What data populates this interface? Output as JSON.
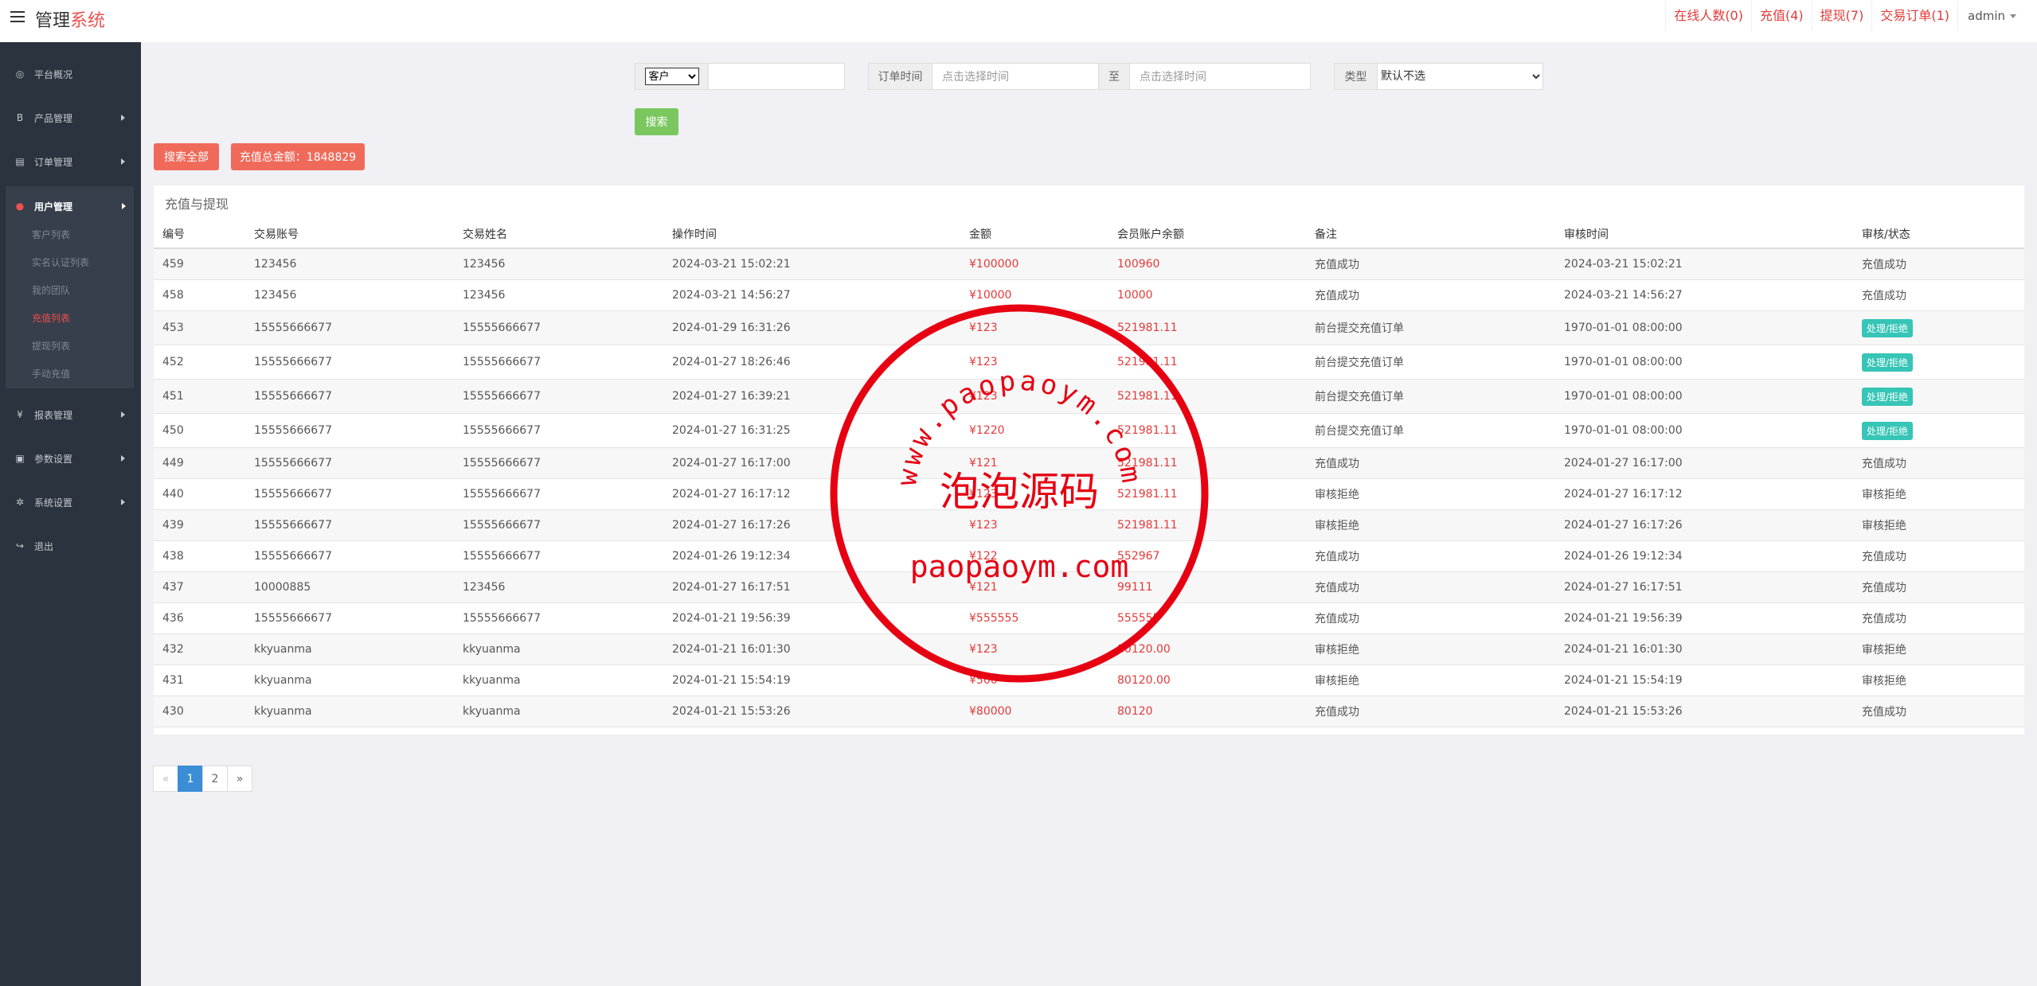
{
  "header": {
    "brand_main": "管理",
    "brand_accent": "系统",
    "links": [
      "在线人数(0)",
      "充值(4)",
      "提现(7)",
      "交易订单(1)"
    ],
    "user": "admin"
  },
  "sidebar": {
    "items": [
      {
        "label": "平台概况",
        "icon": "dashboard-icon",
        "glyph": "◎"
      },
      {
        "label": "产品管理",
        "icon": "bitcoin-icon",
        "glyph": "B"
      },
      {
        "label": "订单管理",
        "icon": "clipboard-icon",
        "glyph": "▤"
      },
      {
        "label": "用户管理",
        "icon": "user-icon",
        "glyph": "●"
      },
      {
        "label": "报表管理",
        "icon": "yen-icon",
        "glyph": "¥"
      },
      {
        "label": "参数设置",
        "icon": "briefcase-icon",
        "glyph": "▣"
      },
      {
        "label": "系统设置",
        "icon": "gears-icon",
        "glyph": "✲"
      },
      {
        "label": "退出",
        "icon": "sign-out-icon",
        "glyph": "↪"
      }
    ],
    "sub_items": [
      "客户列表",
      "实名认证列表",
      "我的团队",
      "充值列表",
      "提现列表",
      "手动充值"
    ]
  },
  "filters": {
    "customer_select": "客户",
    "time_label": "订单时间",
    "start_placeholder": "点击选择时间",
    "to_label": "至",
    "end_placeholder": "点击选择时间",
    "type_label": "类型",
    "type_select": "默认不选",
    "search_label": "搜索",
    "search_all_label": "搜索全部",
    "total_label": "充值总金额：1848829"
  },
  "panel": {
    "title": "充值与提现",
    "columns": [
      "编号",
      "交易账号",
      "交易姓名",
      "操作时间",
      "金额",
      "会员账户余额",
      "备注",
      "审核时间",
      "审核/状态"
    ],
    "rows": [
      {
        "id": "459",
        "account": "123456",
        "name": "123456",
        "time": "2024-03-21 15:02:21",
        "amount": "¥100000",
        "balance": "100960",
        "note": "充值成功",
        "audit_time": "2024-03-21 15:02:21",
        "status": "充值成功",
        "action": false
      },
      {
        "id": "458",
        "account": "123456",
        "name": "123456",
        "time": "2024-03-21 14:56:27",
        "amount": "¥10000",
        "balance": "10000",
        "note": "充值成功",
        "audit_time": "2024-03-21 14:56:27",
        "status": "充值成功",
        "action": false
      },
      {
        "id": "453",
        "account": "15555666677",
        "name": "15555666677",
        "time": "2024-01-29 16:31:26",
        "amount": "¥123",
        "balance": "521981.11",
        "note": "前台提交充值订单",
        "audit_time": "1970-01-01 08:00:00",
        "status": "处理/拒绝",
        "action": true
      },
      {
        "id": "452",
        "account": "15555666677",
        "name": "15555666677",
        "time": "2024-01-27 18:26:46",
        "amount": "¥123",
        "balance": "521981.11",
        "note": "前台提交充值订单",
        "audit_time": "1970-01-01 08:00:00",
        "status": "处理/拒绝",
        "action": true
      },
      {
        "id": "451",
        "account": "15555666677",
        "name": "15555666677",
        "time": "2024-01-27 16:39:21",
        "amount": "¥123",
        "balance": "521981.11",
        "note": "前台提交充值订单",
        "audit_time": "1970-01-01 08:00:00",
        "status": "处理/拒绝",
        "action": true
      },
      {
        "id": "450",
        "account": "15555666677",
        "name": "15555666677",
        "time": "2024-01-27 16:31:25",
        "amount": "¥1220",
        "balance": "521981.11",
        "note": "前台提交充值订单",
        "audit_time": "1970-01-01 08:00:00",
        "status": "处理/拒绝",
        "action": true
      },
      {
        "id": "449",
        "account": "15555666677",
        "name": "15555666677",
        "time": "2024-01-27 16:17:00",
        "amount": "¥121",
        "balance": "521981.11",
        "note": "充值成功",
        "audit_time": "2024-01-27 16:17:00",
        "status": "充值成功",
        "action": false
      },
      {
        "id": "440",
        "account": "15555666677",
        "name": "15555666677",
        "time": "2024-01-27 16:17:12",
        "amount": "¥123",
        "balance": "521981.11",
        "note": "审核拒绝",
        "audit_time": "2024-01-27 16:17:12",
        "status": "审核拒绝",
        "action": false
      },
      {
        "id": "439",
        "account": "15555666677",
        "name": "15555666677",
        "time": "2024-01-27 16:17:26",
        "amount": "¥123",
        "balance": "521981.11",
        "note": "审核拒绝",
        "audit_time": "2024-01-27 16:17:26",
        "status": "审核拒绝",
        "action": false
      },
      {
        "id": "438",
        "account": "15555666677",
        "name": "15555666677",
        "time": "2024-01-26 19:12:34",
        "amount": "¥122",
        "balance": "552967",
        "note": "充值成功",
        "audit_time": "2024-01-26 19:12:34",
        "status": "充值成功",
        "action": false
      },
      {
        "id": "437",
        "account": "10000885",
        "name": "123456",
        "time": "2024-01-27 16:17:51",
        "amount": "¥121",
        "balance": "99111",
        "note": "充值成功",
        "audit_time": "2024-01-27 16:17:51",
        "status": "充值成功",
        "action": false
      },
      {
        "id": "436",
        "account": "15555666677",
        "name": "15555666677",
        "time": "2024-01-21 19:56:39",
        "amount": "¥555555",
        "balance": "555555",
        "note": "充值成功",
        "audit_time": "2024-01-21 19:56:39",
        "status": "充值成功",
        "action": false
      },
      {
        "id": "432",
        "account": "kkyuanma",
        "name": "kkyuanma",
        "time": "2024-01-21 16:01:30",
        "amount": "¥123",
        "balance": "80120.00",
        "note": "审核拒绝",
        "audit_time": "2024-01-21 16:01:30",
        "status": "审核拒绝",
        "action": false
      },
      {
        "id": "431",
        "account": "kkyuanma",
        "name": "kkyuanma",
        "time": "2024-01-21 15:54:19",
        "amount": "¥500",
        "balance": "80120.00",
        "note": "审核拒绝",
        "audit_time": "2024-01-21 15:54:19",
        "status": "审核拒绝",
        "action": false
      },
      {
        "id": "430",
        "account": "kkyuanma",
        "name": "kkyuanma",
        "time": "2024-01-21 15:53:26",
        "amount": "¥80000",
        "balance": "80120",
        "note": "充值成功",
        "audit_time": "2024-01-21 15:53:26",
        "status": "充值成功",
        "action": false
      }
    ]
  },
  "pagination": {
    "prev": "«",
    "pages": [
      "1",
      "2"
    ],
    "next": "»",
    "current": "1"
  },
  "watermark": {
    "arc_text": "www.paopaoym.com",
    "center_text": "泡泡源码",
    "bottom_text": "paopaoym.com",
    "color": "#e60012"
  },
  "colors": {
    "accent": "#f05050",
    "sidebar_bg": "#2b333e",
    "badge": "#36c5b6",
    "search_button": "#7ac75f",
    "page_active": "#3b8ed6"
  }
}
